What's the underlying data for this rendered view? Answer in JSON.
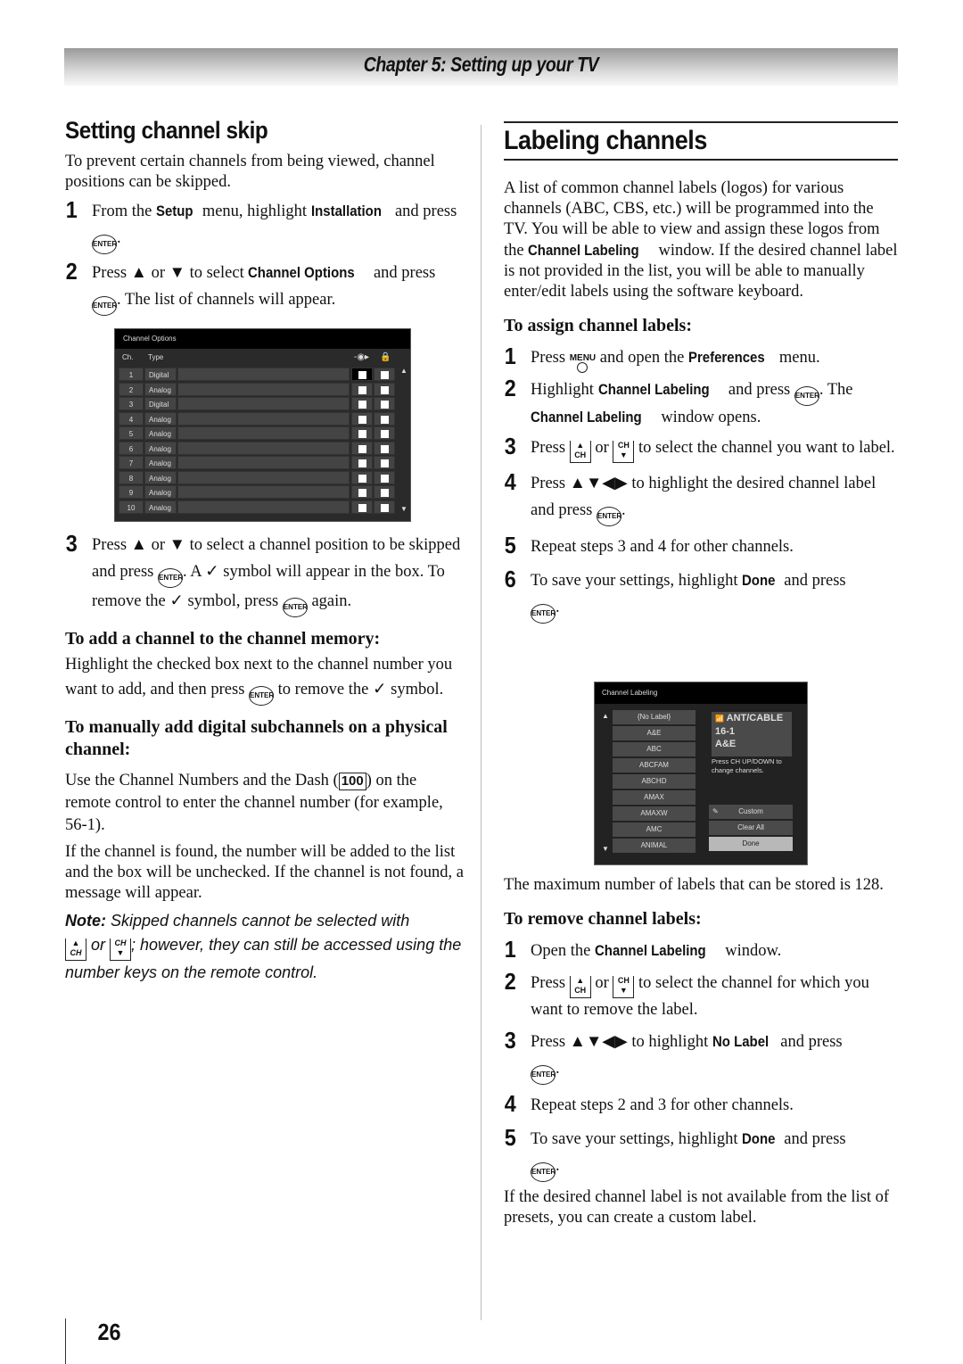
{
  "header": {
    "chapter_title": "Chapter 5: Setting up your TV"
  },
  "left": {
    "title": "Setting channel skip",
    "intro": "To prevent certain channels from being viewed, channel positions can be skipped.",
    "steps": [
      {
        "num": "1",
        "t1": "From the ",
        "b1": "Setup",
        "t2": " menu, highlight ",
        "b2": "Installation",
        "t3": " and press ",
        "t4": "."
      },
      {
        "num": "2",
        "t1": "Press ▲ or ▼ to select ",
        "b1": "Channel Options",
        "t2": " and press ",
        "t3": ". The list of channels will appear."
      },
      {
        "num": "3",
        "t1": "Press ▲ or ▼ to select a channel position to be skipped and press ",
        "t2": ". A ✓ symbol will appear in the box. To remove the ✓ symbol, press ",
        "t3": " again."
      }
    ],
    "sub1": "To add a channel to the channel memory:",
    "sub1_t1": "Highlight the checked box next to the channel number you want to add, and then press ",
    "sub1_t2": " to remove the ✓ symbol.",
    "sub2": "To manually add digital subchannels on a physical channel:",
    "sub2_t1": "Use the Channel Numbers and the Dash (",
    "sub2_dash": "100",
    "sub2_t2": ") on the remote control to enter the channel number (for example, 56-1).",
    "sub2_p2": "If the channel is found, the number will be added to the list and the box will be unchecked. If the channel is not found, a message will appear.",
    "note_label": "Note:",
    "note_t1": " Skipped channels cannot be selected with ",
    "note_or": " or ",
    "note_t2": "; however, they can still be accessed using the number keys on the remote control."
  },
  "channel_options": {
    "title": "Channel Options",
    "col_ch": "Ch.",
    "col_type": "Type",
    "skip_icon": "skip-icon",
    "lock_icon": "lock-icon",
    "rows": [
      {
        "ch": "1",
        "type": "Digital"
      },
      {
        "ch": "2",
        "type": "Analog"
      },
      {
        "ch": "3",
        "type": "Digital"
      },
      {
        "ch": "4",
        "type": "Analog"
      },
      {
        "ch": "5",
        "type": "Analog"
      },
      {
        "ch": "6",
        "type": "Analog"
      },
      {
        "ch": "7",
        "type": "Analog"
      },
      {
        "ch": "8",
        "type": "Analog"
      },
      {
        "ch": "9",
        "type": "Analog"
      },
      {
        "ch": "10",
        "type": "Analog"
      }
    ]
  },
  "right": {
    "title": "Labeling channels",
    "intro_t1": "A list of common channel labels (logos) for various channels (ABC, CBS, etc.) will be programmed into the TV. You will be able to view and assign these logos from the ",
    "intro_b": "Channel Labeling",
    "intro_t2": " window. If the desired channel label is not provided in the list, you will be able to manually enter/edit labels using the software keyboard.",
    "assign_title": "To assign channel labels:",
    "assign": {
      "s1": {
        "num": "1",
        "t1": "Press ",
        "menu": "MENU",
        "t2": " and open the ",
        "b": "Preferences",
        "t3": " menu."
      },
      "s2": {
        "num": "2",
        "t1": "Highlight ",
        "b1": "Channel Labeling",
        "t2": " and press ",
        "t3": ". The ",
        "b2": "Channel Labeling",
        "t4": " window opens."
      },
      "s3": {
        "num": "3",
        "t1": "Press ",
        "t2": " or ",
        "t3": " to select the channel you want to label."
      },
      "s4": {
        "num": "4",
        "t1": "Press ▲▼◀▶ to highlight the desired channel label and press ",
        "t2": "."
      },
      "s5": {
        "num": "5",
        "t1": "Repeat steps 3 and 4 for other channels."
      },
      "s6": {
        "num": "6",
        "t1": "To save your settings, highlight ",
        "b": "Done",
        "t2": " and press ",
        "t3": "."
      }
    },
    "max_labels": "The maximum number of labels that can be stored is 128.",
    "remove_title": "To remove channel labels:",
    "remove": {
      "s1": {
        "num": "1",
        "t1": "Open the ",
        "b": "Channel Labeling",
        "t2": " window."
      },
      "s2": {
        "num": "2",
        "t1": "Press ",
        "t2": " or ",
        "t3": " to select the channel for which you want to remove the label."
      },
      "s3": {
        "num": "3",
        "t1": "Press ▲▼◀▶ to highlight ",
        "b": "No Label",
        "t2": " and press ",
        "t3": "."
      },
      "s4": {
        "num": "4",
        "t1": "Repeat steps 2 and 3 for other channels."
      },
      "s5": {
        "num": "5",
        "t1": "To save your settings, highlight ",
        "b": "Done",
        "t2": " and press ",
        "t3": "."
      }
    },
    "closing": "If the desired channel label is not available from the list of presets, you can create a custom label."
  },
  "channel_labeling": {
    "title": "Channel Labeling",
    "labels": [
      "{No Label}",
      "A&E",
      "ABC",
      "ABCFAM",
      "ABCHD",
      "AMAX",
      "AMAXW",
      "AMC",
      "ANIMAL"
    ],
    "preview_source": "ANT/CABLE",
    "preview_channel": "16-1",
    "preview_label": "A&E",
    "hint": "Press CH UP/DOWN to change channels.",
    "btn_custom": "Custom",
    "btn_clear": "Clear All",
    "btn_done": "Done"
  },
  "icons": {
    "enter": "ENTER",
    "ch": "CH",
    "up": "▲",
    "down": "▼"
  },
  "page_number": "26"
}
